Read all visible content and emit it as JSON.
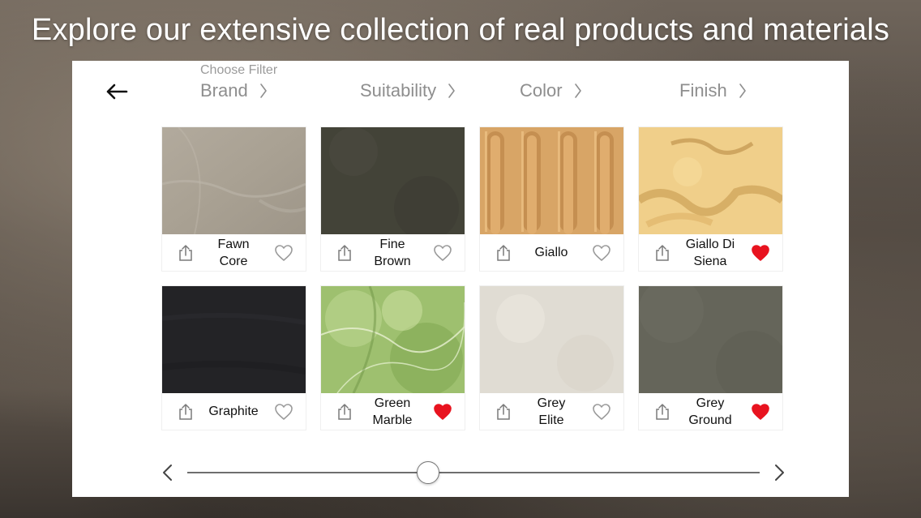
{
  "headline": "Explore our extensive collection of real products and materials",
  "filters": {
    "caption": "Choose Filter",
    "items": [
      "Brand",
      "Suitability",
      "Color",
      "Finish"
    ]
  },
  "products": [
    {
      "name_lines": [
        "Fawn",
        "Core"
      ],
      "favorite": false,
      "swatch": "fawn-core"
    },
    {
      "name_lines": [
        "Fine",
        "Brown"
      ],
      "favorite": false,
      "swatch": "fine-brown"
    },
    {
      "name_lines": [
        "Giallo"
      ],
      "favorite": false,
      "swatch": "giallo"
    },
    {
      "name_lines": [
        "Giallo Di",
        "Siena"
      ],
      "favorite": true,
      "swatch": "giallo-di-siena"
    },
    {
      "name_lines": [
        "Graphite"
      ],
      "favorite": false,
      "swatch": "graphite"
    },
    {
      "name_lines": [
        "Green",
        "Marble"
      ],
      "favorite": true,
      "swatch": "green-marble"
    },
    {
      "name_lines": [
        "Grey",
        "Elite"
      ],
      "favorite": false,
      "swatch": "grey-elite"
    },
    {
      "name_lines": [
        "Grey",
        "Ground"
      ],
      "favorite": true,
      "swatch": "grey-ground"
    }
  ],
  "slider": {
    "position": 0.42
  },
  "colors": {
    "favorite": "#e8131f",
    "unfavorite": "#9a9a9a",
    "filter_text": "#8e8e8e"
  },
  "icons": {
    "back": "arrow-left-icon",
    "share": "share-icon",
    "favorite": "heart-icon",
    "prev": "chevron-left-icon",
    "next": "chevron-right-icon"
  }
}
